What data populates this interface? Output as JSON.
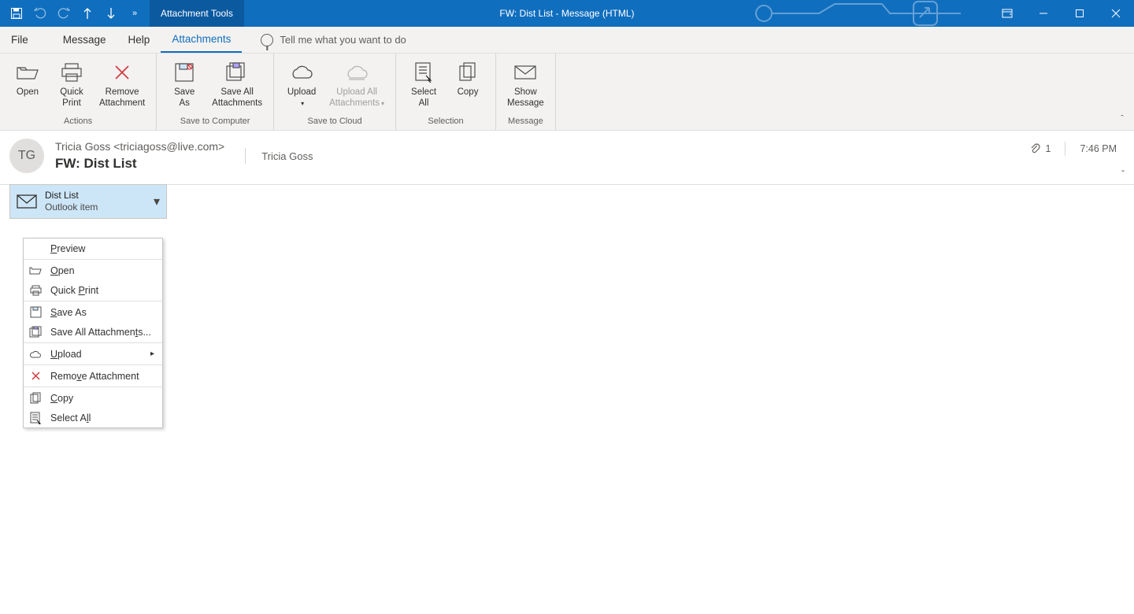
{
  "titlebar": {
    "context_tab": "Attachment Tools",
    "title": "FW: Dist List  -  Message (HTML)"
  },
  "tabs": {
    "file": "File",
    "message": "Message",
    "help": "Help",
    "attachments": "Attachments",
    "tell_me": "Tell me what you want to do"
  },
  "ribbon": {
    "actions": {
      "open": "Open",
      "quick_print_l1": "Quick",
      "quick_print_l2": "Print",
      "remove_l1": "Remove",
      "remove_l2": "Attachment",
      "group_label": "Actions"
    },
    "save_computer": {
      "save_as_l1": "Save",
      "save_as_l2": "As",
      "save_all_l1": "Save All",
      "save_all_l2": "Attachments",
      "group_label": "Save to Computer"
    },
    "save_cloud": {
      "upload": "Upload",
      "upload_all_l1": "Upload All",
      "upload_all_l2": "Attachments",
      "group_label": "Save to Cloud"
    },
    "selection": {
      "select_all_l1": "Select",
      "select_all_l2": "All",
      "copy": "Copy",
      "group_label": "Selection"
    },
    "message": {
      "show_msg_l1": "Show",
      "show_msg_l2": "Message",
      "group_label": "Message"
    }
  },
  "header": {
    "avatar": "TG",
    "from": "Tricia Goss <triciagoss@live.com>",
    "subject": "FW: Dist List",
    "to": "Tricia Goss",
    "attach_count": "1",
    "time": "7:46 PM"
  },
  "attachment": {
    "name": "Dist List",
    "type": "Outlook item"
  },
  "ctx": {
    "preview": "review",
    "open": "pen",
    "quick_print": "Quick ",
    "quick_print2": "rint",
    "save_as": "ave As",
    "save_all": "Save All Attachmen",
    "save_all2": "s...",
    "upload": "pload",
    "remove": "Remo",
    "remove2": "e Attachment",
    "copy": "opy",
    "select_all": "Select A",
    "select_all2": "l"
  }
}
